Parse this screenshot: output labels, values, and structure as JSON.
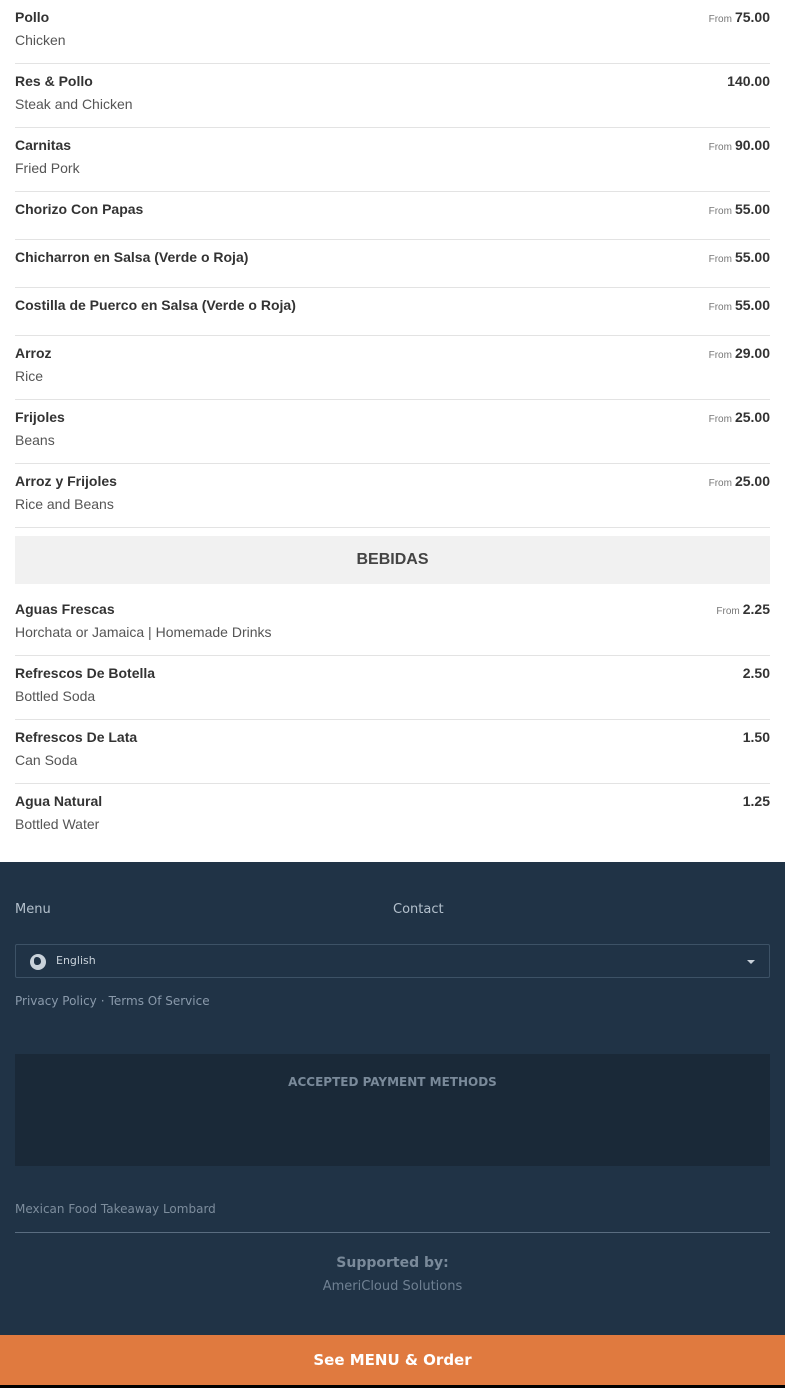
{
  "menu_items_a": [
    {
      "name": "Pollo",
      "desc": "Chicken",
      "from": "From",
      "price": "75.00"
    },
    {
      "name": "Res & Pollo",
      "desc": "Steak and Chicken",
      "from": "",
      "price": "140.00"
    },
    {
      "name": "Carnitas",
      "desc": "Fried Pork",
      "from": "From",
      "price": "90.00"
    },
    {
      "name": "Chorizo Con Papas",
      "desc": "",
      "from": "From",
      "price": "55.00"
    },
    {
      "name": "Chicharron en Salsa (Verde o Roja)",
      "desc": "",
      "from": "From",
      "price": "55.00"
    },
    {
      "name": "Costilla de Puerco en Salsa (Verde o Roja)",
      "desc": "",
      "from": "From",
      "price": "55.00"
    },
    {
      "name": "Arroz",
      "desc": "Rice",
      "from": "From",
      "price": "29.00"
    },
    {
      "name": "Frijoles",
      "desc": "Beans",
      "from": "From",
      "price": "25.00"
    },
    {
      "name": "Arroz y Frijoles",
      "desc": "Rice and Beans",
      "from": "From",
      "price": "25.00"
    }
  ],
  "section_drinks": "BEBIDAS",
  "menu_items_b": [
    {
      "name": "Aguas Frescas",
      "desc": "Horchata or Jamaica | Homemade Drinks",
      "from": "From",
      "price": "2.25"
    },
    {
      "name": "Refrescos De Botella",
      "desc": "Bottled Soda",
      "from": "",
      "price": "2.50"
    },
    {
      "name": "Refrescos De Lata",
      "desc": "Can Soda",
      "from": "",
      "price": "1.50"
    },
    {
      "name": "Agua Natural",
      "desc": "Bottled Water",
      "from": "",
      "price": "1.25"
    }
  ],
  "footer": {
    "menu_link": "Menu",
    "contact_link": "Contact",
    "language": "English",
    "privacy": "Privacy Policy",
    "separator": "·",
    "terms": "Terms Of Service",
    "payments_title": "ACCEPTED PAYMENT METHODS",
    "business": "Mexican Food Takeaway Lombard",
    "supported_by": "Supported by:",
    "company": "AmeriCloud Solutions"
  },
  "cta": "See MENU & Order",
  "colors": {
    "footer_bg": "#203346",
    "cta_bg": "#e07a3f"
  }
}
